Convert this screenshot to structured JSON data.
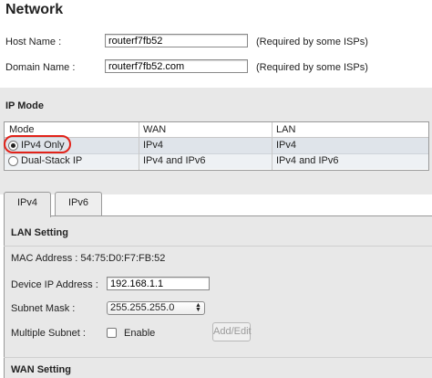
{
  "page": {
    "title": "Network"
  },
  "basic": {
    "host_name_label": "Host Name :",
    "host_name_value": "routerf7fb52",
    "host_name_hint": "(Required by some ISPs)",
    "domain_name_label": "Domain Name :",
    "domain_name_value": "routerf7fb52.com",
    "domain_name_hint": "(Required by some ISPs)"
  },
  "ip_mode": {
    "section_title": "IP Mode",
    "columns": [
      "Mode",
      "WAN",
      "LAN"
    ],
    "rows": [
      {
        "mode": "IPv4 Only",
        "wan": "IPv4",
        "lan": "IPv4",
        "selected": true
      },
      {
        "mode": "Dual-Stack IP",
        "wan": "IPv4 and IPv6",
        "lan": "IPv4 and IPv6",
        "selected": false
      }
    ],
    "highlight_color": "#e2231a"
  },
  "tabs": [
    {
      "label": "IPv4",
      "active": true
    },
    {
      "label": "IPv6",
      "active": false
    }
  ],
  "lan": {
    "section_title": "LAN Setting",
    "mac_label": "MAC Address : 54:75:D0:F7:FB:52",
    "device_ip_label": "Device IP Address :",
    "device_ip_value": "192.168.1.1",
    "subnet_label": "Subnet Mask :",
    "subnet_value": "255.255.255.0",
    "multiple_subnet_label": "Multiple Subnet :",
    "enable_label": "Enable",
    "enable_checked": false,
    "add_edit_label": "Add/Edit"
  },
  "wan": {
    "section_title": "WAN Setting"
  }
}
